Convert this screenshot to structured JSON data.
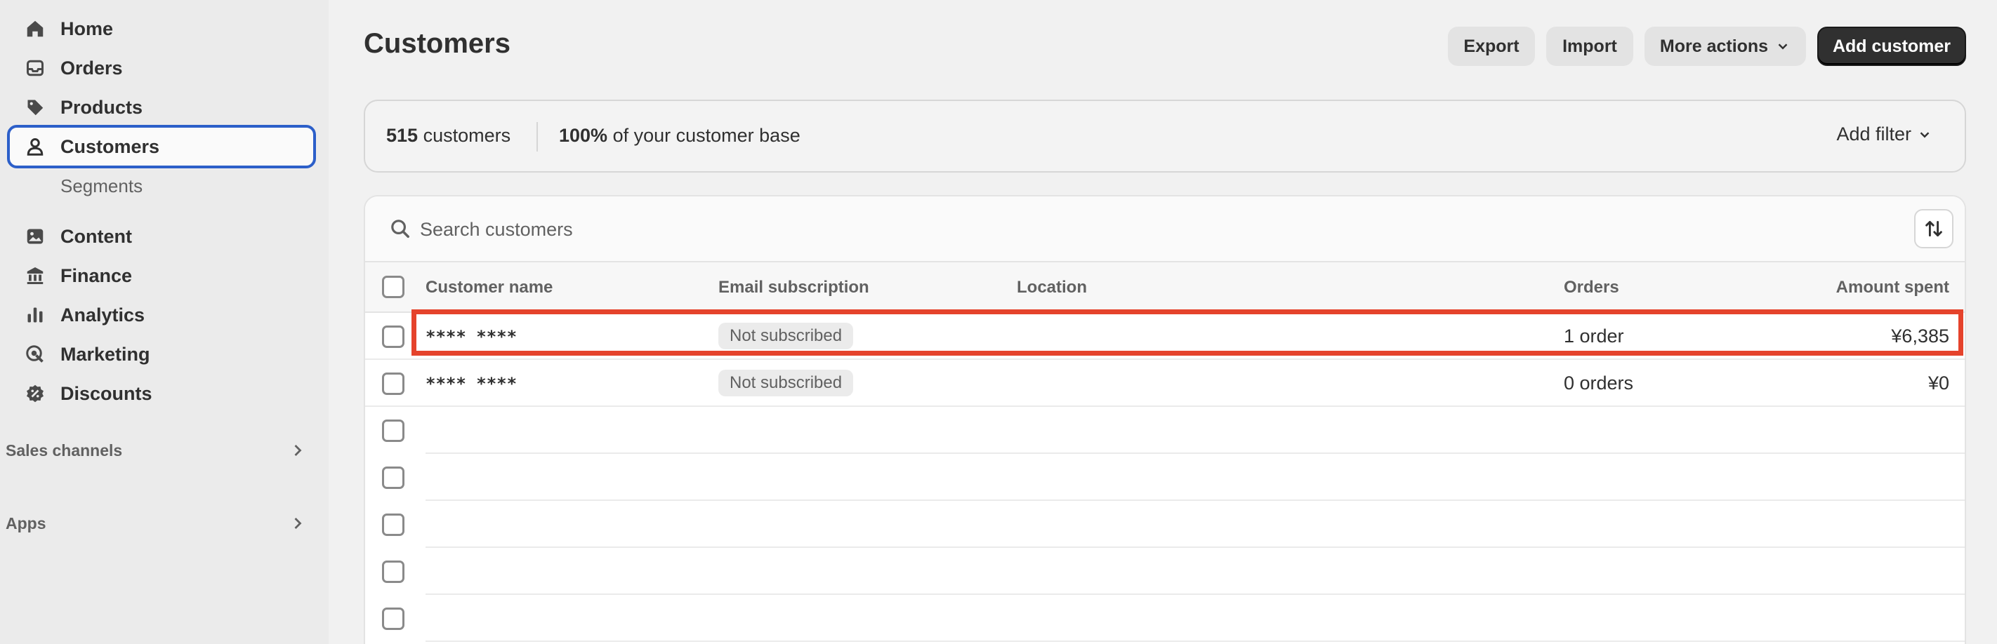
{
  "sidebar": {
    "items": [
      {
        "label": "Home",
        "icon": "home-icon"
      },
      {
        "label": "Orders",
        "icon": "inbox-icon"
      },
      {
        "label": "Products",
        "icon": "tag-icon"
      },
      {
        "label": "Customers",
        "icon": "person-icon",
        "active": true
      },
      {
        "label": "Content",
        "icon": "image-icon"
      },
      {
        "label": "Finance",
        "icon": "bank-icon"
      },
      {
        "label": "Analytics",
        "icon": "bar-chart-icon"
      },
      {
        "label": "Marketing",
        "icon": "target-icon"
      },
      {
        "label": "Discounts",
        "icon": "discount-icon"
      }
    ],
    "sub_item": "Segments",
    "sections": [
      {
        "label": "Sales channels"
      },
      {
        "label": "Apps"
      }
    ]
  },
  "header": {
    "title": "Customers",
    "export_label": "Export",
    "import_label": "Import",
    "more_actions_label": "More actions",
    "add_customer_label": "Add customer"
  },
  "summary": {
    "count_number": "515",
    "count_word": "customers",
    "pct_number": "100%",
    "pct_text": "of your customer base",
    "add_filter_label": "Add filter"
  },
  "search": {
    "placeholder": "Search customers"
  },
  "table": {
    "columns": {
      "name": "Customer name",
      "email": "Email subscription",
      "location": "Location",
      "orders": "Orders",
      "amount": "Amount spent"
    },
    "rows": [
      {
        "name": "**** ****",
        "email": "Not subscribed",
        "location": "",
        "orders": "1 order",
        "amount": "¥6,385"
      },
      {
        "name": "**** ****",
        "email": "Not subscribed",
        "location": "",
        "orders": "0 orders",
        "amount": "¥0"
      }
    ]
  },
  "colors": {
    "accent_border": "#2c5fc9",
    "highlight": "#e5432c",
    "primary_button": "#303030"
  }
}
